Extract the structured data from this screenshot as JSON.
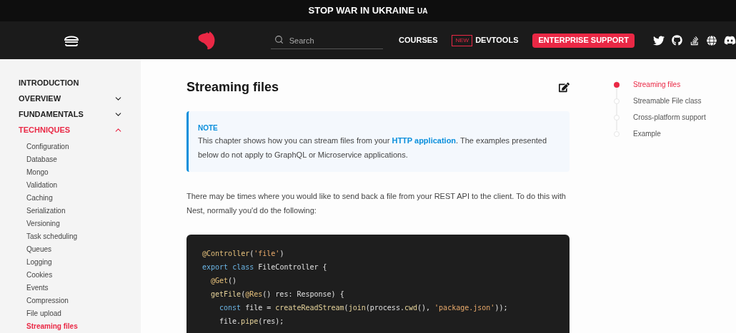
{
  "banner": {
    "text": "STOP WAR IN UKRAINE",
    "suffix": "UA"
  },
  "header": {
    "search": {
      "placeholder": "Search"
    },
    "nav": [
      {
        "kind": "link",
        "label": "COURSES"
      },
      {
        "kind": "badged",
        "badge": "NEW",
        "label": "DEVTOOLS"
      },
      {
        "kind": "button",
        "label": "ENTERPRISE SUPPORT"
      }
    ]
  },
  "sidebar": {
    "sections": [
      {
        "label": "INTRODUCTION",
        "kind": "link",
        "expanded": false
      },
      {
        "label": "OVERVIEW",
        "kind": "group",
        "expanded": false
      },
      {
        "label": "FUNDAMENTALS",
        "kind": "group",
        "expanded": false
      },
      {
        "label": "TECHNIQUES",
        "kind": "group",
        "expanded": true,
        "children": [
          {
            "label": "Configuration",
            "selected": false
          },
          {
            "label": "Database",
            "selected": false
          },
          {
            "label": "Mongo",
            "selected": false
          },
          {
            "label": "Validation",
            "selected": false
          },
          {
            "label": "Caching",
            "selected": false
          },
          {
            "label": "Serialization",
            "selected": false
          },
          {
            "label": "Versioning",
            "selected": false
          },
          {
            "label": "Task scheduling",
            "selected": false
          },
          {
            "label": "Queues",
            "selected": false
          },
          {
            "label": "Logging",
            "selected": false
          },
          {
            "label": "Cookies",
            "selected": false
          },
          {
            "label": "Events",
            "selected": false
          },
          {
            "label": "Compression",
            "selected": false
          },
          {
            "label": "File upload",
            "selected": false
          },
          {
            "label": "Streaming files",
            "selected": true
          }
        ]
      }
    ]
  },
  "article": {
    "title": "Streaming files",
    "note": {
      "label": "NOTE",
      "before": "This chapter shows how you can stream files from your ",
      "link": "HTTP application",
      "after": ". The examples presented below do not apply to GraphQL or Microservice applications."
    },
    "paragraph": "There may be times where you would like to send back a file from your REST API to the client. To do this with Nest, normally you'd do the following:",
    "code": [
      {
        "kind": "outer",
        "tokens": [
          {
            "kind": "decorator",
            "text": "@Controller"
          },
          {
            "kind": "plain",
            "text": "("
          },
          {
            "kind": "string",
            "text": "'file'"
          },
          {
            "kind": "plain",
            "text": ")"
          }
        ]
      },
      {
        "kind": "outer",
        "tokens": [
          {
            "kind": "keyword",
            "text": "export class "
          },
          {
            "kind": "plain",
            "text": "FileController {"
          }
        ]
      },
      {
        "kind": "member",
        "tokens": [
          {
            "kind": "decorator",
            "text": "@Get"
          },
          {
            "kind": "plain",
            "text": "()"
          }
        ]
      },
      {
        "kind": "member",
        "tokens": [
          {
            "kind": "function",
            "text": "getFile"
          },
          {
            "kind": "plain",
            "text": "("
          },
          {
            "kind": "decorator",
            "text": "@Res"
          },
          {
            "kind": "plain",
            "text": "() res: Response) {"
          }
        ]
      },
      {
        "kind": "body",
        "tokens": [
          {
            "kind": "keyword",
            "text": "const "
          },
          {
            "kind": "plain",
            "text": "file = "
          },
          {
            "kind": "function",
            "text": "createReadStream"
          },
          {
            "kind": "plain",
            "text": "("
          },
          {
            "kind": "function",
            "text": "join"
          },
          {
            "kind": "plain",
            "text": "(process."
          },
          {
            "kind": "function",
            "text": "cwd"
          },
          {
            "kind": "plain",
            "text": "(), "
          },
          {
            "kind": "string",
            "text": "'package.json'"
          },
          {
            "kind": "plain",
            "text": "));"
          }
        ]
      },
      {
        "kind": "body",
        "tokens": [
          {
            "kind": "plain",
            "text": "file."
          },
          {
            "kind": "function",
            "text": "pipe"
          },
          {
            "kind": "plain",
            "text": "(res);"
          }
        ]
      }
    ]
  },
  "toc": [
    {
      "label": "Streaming files",
      "selected": true
    },
    {
      "label": "Streamable File class",
      "selected": false
    },
    {
      "label": "Cross-platform support",
      "selected": false
    },
    {
      "label": "Example",
      "selected": false
    }
  ]
}
